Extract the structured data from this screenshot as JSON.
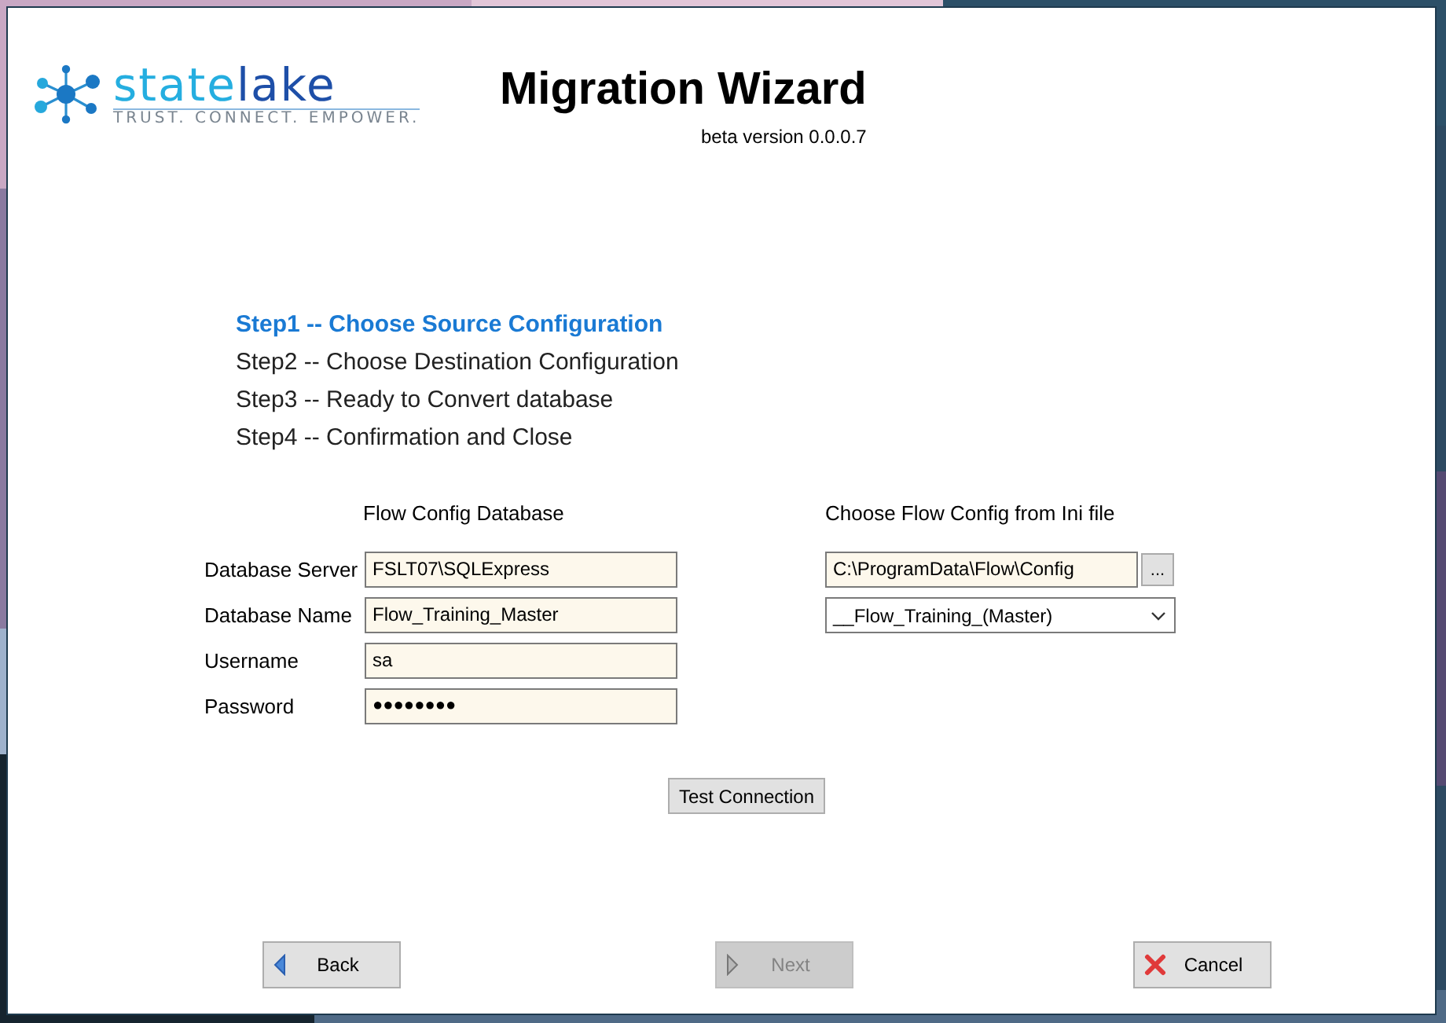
{
  "logo": {
    "name_parts": [
      "state",
      "lake"
    ],
    "tagline": "TRUST. CONNECT. EMPOWER."
  },
  "header": {
    "title": "Migration Wizard",
    "version": "beta version 0.0.0.7"
  },
  "steps": [
    {
      "label": "Step1 -- Choose Source Configuration",
      "selected": true
    },
    {
      "label": "Step2 -- Choose Destination Configuration",
      "selected": false
    },
    {
      "label": "Step3 -- Ready to Convert database",
      "selected": false
    },
    {
      "label": "Step4 -- Confirmation and Close",
      "selected": false
    }
  ],
  "database": {
    "heading": "Flow Config Database",
    "fields": [
      {
        "label": "Database Server",
        "value": "FSLT07\\SQLExpress",
        "kind": "text"
      },
      {
        "label": "Database Name",
        "value": "Flow_Training_Master",
        "kind": "text"
      },
      {
        "label": "Username",
        "value": "sa",
        "kind": "text"
      },
      {
        "label": "Password",
        "value": "●●●●●●●●",
        "kind": "password"
      }
    ]
  },
  "ini": {
    "heading": "Choose Flow Config from Ini file",
    "path": "C:\\ProgramData\\Flow\\Config",
    "browse": "...",
    "selection": "__Flow_Training_(Master)"
  },
  "test_button": "Test Connection",
  "nav_buttons": [
    {
      "label": "Back",
      "kind": "back",
      "disabled": false
    },
    {
      "label": "Next",
      "kind": "next",
      "disabled": true
    },
    {
      "label": "Cancel",
      "kind": "cancel",
      "disabled": false
    }
  ]
}
